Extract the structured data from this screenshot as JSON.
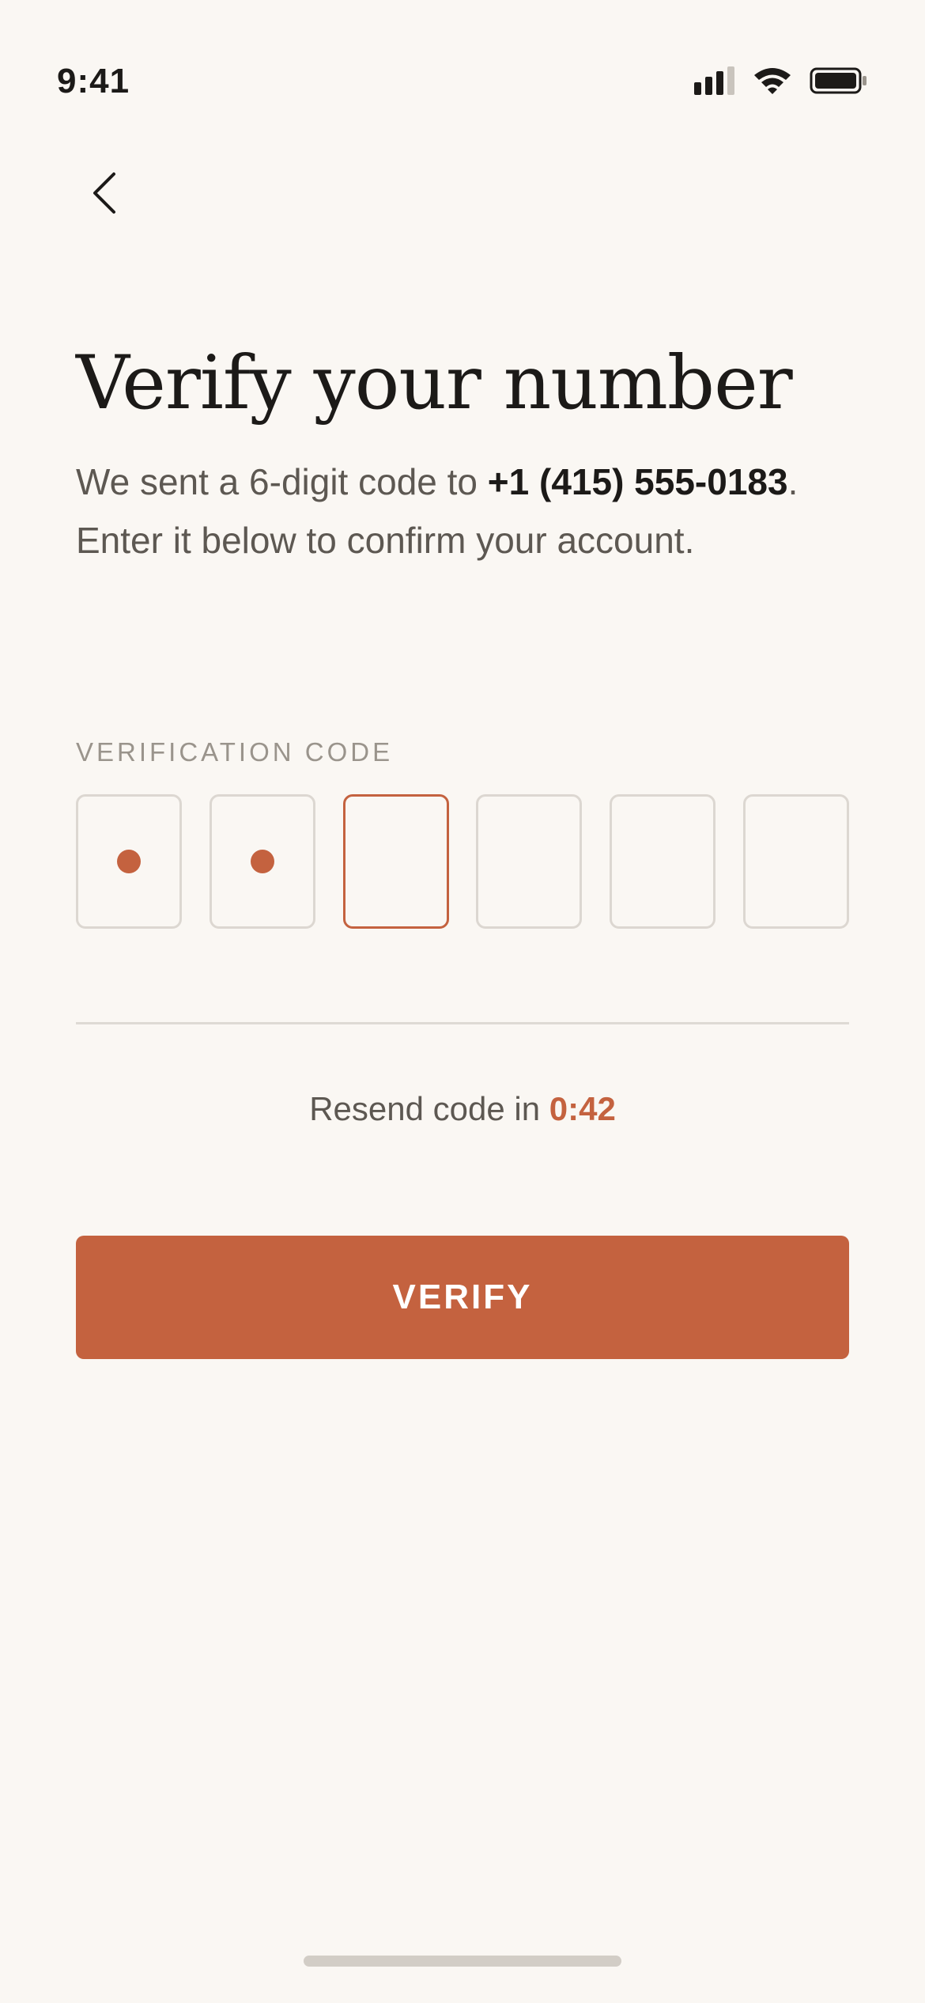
{
  "status_bar": {
    "time": "9:41",
    "icons": [
      "cellular-signal-icon",
      "wifi-icon",
      "battery-icon"
    ]
  },
  "nav": {
    "back_icon": "chevron-left-icon"
  },
  "header": {
    "title": "Verify your number",
    "subtitle_before": "We sent a 6-digit code to ",
    "phone_number": "+1 (415) 555-0183",
    "subtitle_after": ". Enter it below to confirm your account."
  },
  "verification": {
    "label": "VERIFICATION CODE",
    "digit_count": 6,
    "filled_count": 2,
    "active_index": 2
  },
  "resend": {
    "prefix": "Resend code in ",
    "timer": "0:42"
  },
  "actions": {
    "verify_label": "VERIFY"
  },
  "colors": {
    "background": "#faf7f3",
    "accent": "#c4623f",
    "text_primary": "#1c1a18",
    "text_secondary": "#5d5852",
    "border": "#dcd7d1"
  }
}
